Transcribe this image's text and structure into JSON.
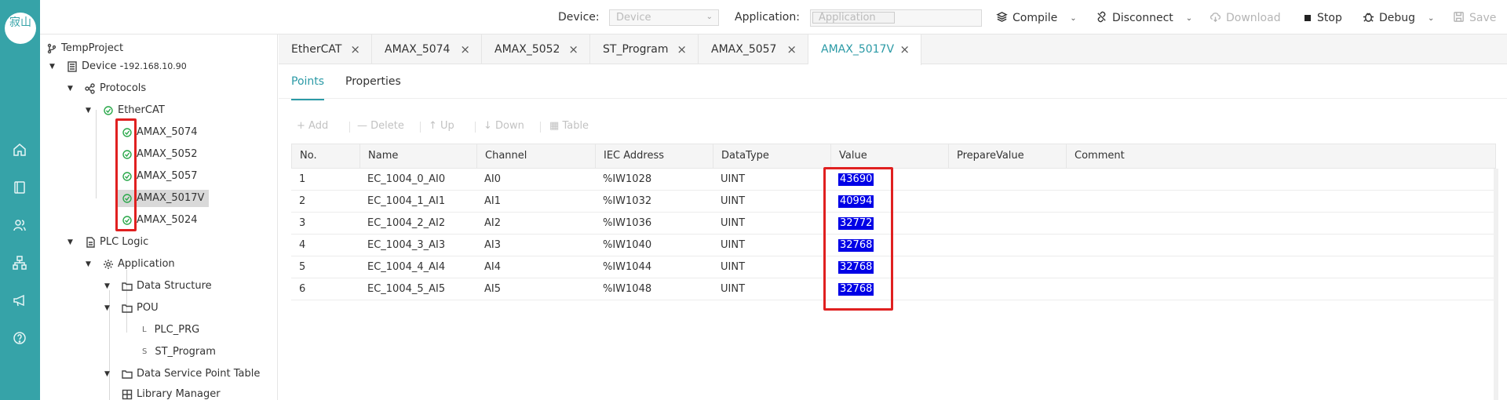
{
  "rail": {
    "logo_text": "寂山",
    "icons": [
      "home-icon",
      "book-icon",
      "users-icon",
      "sitemap-icon",
      "megaphone-icon",
      "help-icon"
    ]
  },
  "toolbar": {
    "device_label": "Device:",
    "device_placeholder": "Device",
    "application_label": "Application:",
    "application_placeholder": "Application",
    "compile": "Compile",
    "disconnect": "Disconnect",
    "download": "Download",
    "stop": "Stop",
    "debug": "Debug",
    "save": "Save"
  },
  "tree": {
    "project": "TempProject",
    "device": "Device - ",
    "device_ip": "192.168.10.90",
    "protocols": "Protocols",
    "ethercat": "EtherCAT",
    "modules": [
      "AMAX_5074",
      "AMAX_5052",
      "AMAX_5057",
      "AMAX_5017V",
      "AMAX_5024"
    ],
    "selected_module": "AMAX_5017V",
    "plc_logic": "PLC Logic",
    "application": "Application",
    "data_structure": "Data Structure",
    "pou": "POU",
    "plc_prg": "PLC_PRG",
    "plc_prg_prefix": "L",
    "st_program": "ST_Program",
    "st_program_prefix": "S",
    "data_service": "Data Service Point Table",
    "library_manager": "Library Manager"
  },
  "tabs": [
    "EtherCAT",
    "AMAX_5074",
    "AMAX_5052",
    "ST_Program",
    "AMAX_5057",
    "AMAX_5017V"
  ],
  "active_tab": "AMAX_5017V",
  "subtabs": [
    "Points",
    "Properties"
  ],
  "active_subtab": "Points",
  "actions": {
    "add": "+ Add",
    "delete": "— Delete",
    "up": "↑ Up",
    "down": "↓ Down",
    "table": "Table"
  },
  "table": {
    "columns": [
      "No.",
      "Name",
      "Channel",
      "IEC Address",
      "DataType",
      "Value",
      "PrepareValue",
      "Comment"
    ],
    "rows": [
      {
        "no": "1",
        "name": "EC_1004_0_AI0",
        "channel": "AI0",
        "iec": "%IW1028",
        "type": "UINT",
        "value": "43690"
      },
      {
        "no": "2",
        "name": "EC_1004_1_AI1",
        "channel": "AI1",
        "iec": "%IW1032",
        "type": "UINT",
        "value": "40994"
      },
      {
        "no": "3",
        "name": "EC_1004_2_AI2",
        "channel": "AI2",
        "iec": "%IW1036",
        "type": "UINT",
        "value": "32772"
      },
      {
        "no": "4",
        "name": "EC_1004_3_AI3",
        "channel": "AI3",
        "iec": "%IW1040",
        "type": "UINT",
        "value": "32768"
      },
      {
        "no": "5",
        "name": "EC_1004_4_AI4",
        "channel": "AI4",
        "iec": "%IW1044",
        "type": "UINT",
        "value": "32768"
      },
      {
        "no": "6",
        "name": "EC_1004_5_AI5",
        "channel": "AI5",
        "iec": "%IW1048",
        "type": "UINT",
        "value": "32768"
      }
    ]
  },
  "colors": {
    "accent": "#2b9aa6",
    "rail": "#36a3a8",
    "highlight": "#e02020",
    "value_bg": "#0000e6",
    "ok": "#2aa84a"
  }
}
